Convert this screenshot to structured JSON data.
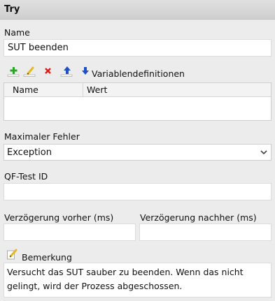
{
  "header": {
    "title": "Try"
  },
  "name_field": {
    "label": "Name",
    "value": "SUT beenden"
  },
  "variables": {
    "toolbar": {
      "add_icon": "plus-icon",
      "edit_icon": "pencil-icon",
      "delete_icon": "x-icon",
      "move_up_icon": "arrow-up-icon",
      "move_down_icon": "arrow-down-icon"
    },
    "title": "Variablendefinitionen",
    "columns": [
      "Name",
      "Wert"
    ],
    "rows": []
  },
  "max_error": {
    "label": "Maximaler Fehler",
    "selected": "Exception"
  },
  "qftest_id": {
    "label": "QF-Test ID",
    "value": ""
  },
  "delay_before": {
    "label": "Verzögerung vorher (ms)",
    "value": ""
  },
  "delay_after": {
    "label": "Verzögerung nachher (ms)",
    "value": ""
  },
  "comment": {
    "label": "Bemerkung",
    "line1": "Versucht das SUT sauber zu beenden. Wenn das nicht",
    "line2": "gelingt, wird der Prozess abgeschossen."
  },
  "colors": {
    "add_green": "#2aa52a",
    "delete_red": "#d42020",
    "arrow_blue": "#1f4fc8",
    "pencil_yellow": "#e8b820"
  }
}
